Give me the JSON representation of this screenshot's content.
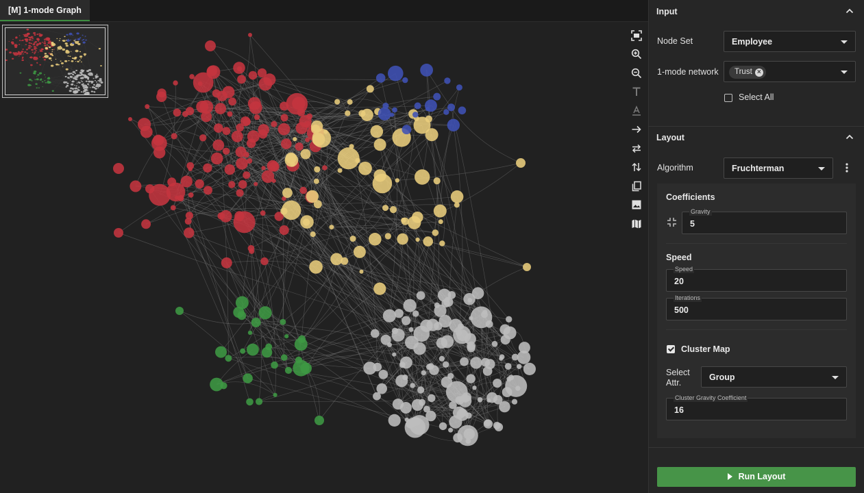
{
  "tab": {
    "title": "[M] 1-mode Graph"
  },
  "colors": {
    "red": "#c4343f",
    "yellow": "#e9cd7c",
    "blue": "#3f51b5",
    "green": "#3e9843",
    "gray": "#bdbdbd",
    "edge": "#7c7c7c",
    "run_button": "#479448"
  },
  "toolbar": {
    "icons": [
      "fit-screen-icon",
      "zoom-in-icon",
      "zoom-out-icon",
      "text-icon",
      "text-format-icon",
      "arrow-right-icon",
      "swap-horizontal-icon",
      "swap-vertical-icon",
      "copy-icon",
      "image-icon",
      "map-icon"
    ]
  },
  "input": {
    "title": "Input",
    "node_set_label": "Node Set",
    "node_set_value": "Employee",
    "network_label": "1-mode network",
    "network_chip": "Trust",
    "select_all_label": "Select All"
  },
  "layout": {
    "title": "Layout",
    "algorithm_label": "Algorithm",
    "algorithm_value": "Fruchterman",
    "coefficients_title": "Coefficients",
    "gravity_label": "Gravity",
    "gravity_value": "5",
    "speed_title": "Speed",
    "speed_label": "Speed",
    "speed_value": "20",
    "iterations_label": "Iterations",
    "iterations_value": "500",
    "cluster_map_label": "Cluster Map",
    "cluster_map_checked": true,
    "select_attr_label_1": "Select",
    "select_attr_label_2": "Attr.",
    "select_attr_value": "Group",
    "cluster_gravity_label": "Cluster Gravity Coefficient",
    "cluster_gravity_value": "16"
  },
  "run_button": {
    "label": "Run Layout"
  }
}
